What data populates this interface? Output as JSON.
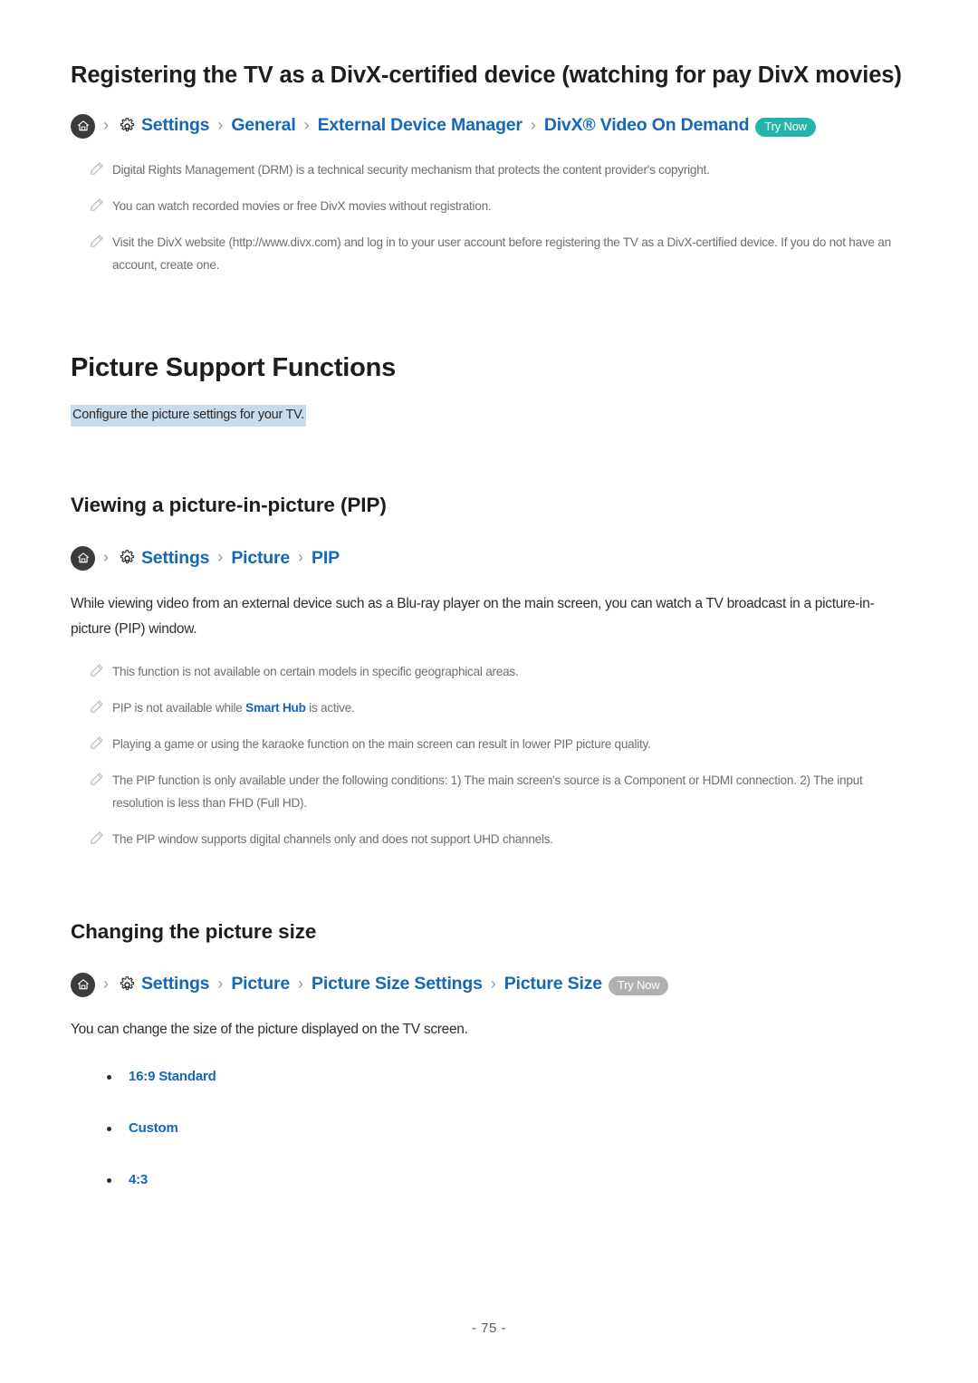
{
  "document": {
    "page_number": "- 75 -"
  },
  "section_divx": {
    "heading": "Registering the TV as a DivX-certified device (watching for pay DivX movies)",
    "breadcrumb": {
      "home_icon": "home-icon",
      "gear_icon": "gear-icon",
      "separator": "›",
      "items": [
        "Settings",
        "General",
        "External Device Manager",
        "DivX® Video On Demand"
      ],
      "badge": "Try Now",
      "badge_color": "#23b5ab"
    },
    "notes": [
      "Digital Rights Management (DRM) is a technical security mechanism that protects the content provider's copyright.",
      "You can watch recorded movies or free DivX movies without registration.",
      "Visit the DivX website (http://www.divx.com) and log in to your user account before registering the TV as a DivX-certified device. If you do not have an account, create one."
    ]
  },
  "section_picture_support": {
    "heading": "Picture Support Functions",
    "lead": "Configure the picture settings for your TV.",
    "lead_highlight_color": "#c6dcef"
  },
  "section_pip": {
    "heading": "Viewing a picture-in-picture (PIP)",
    "breadcrumb": {
      "home_icon": "home-icon",
      "gear_icon": "gear-icon",
      "separator": "›",
      "items": [
        "Settings",
        "Picture",
        "PIP"
      ]
    },
    "body": "While viewing video from an external device such as a Blu-ray player on the main screen, you can watch a TV broadcast in a picture-in-picture (PIP) window.",
    "notes": [
      {
        "text": "This function is not available on certain models in specific geographical areas."
      },
      {
        "prefix": "PIP is not available while ",
        "link": "Smart Hub",
        "suffix": " is active."
      },
      {
        "text": "Playing a game or using the karaoke function on the main screen can result in lower PIP picture quality."
      },
      {
        "text": "The PIP function is only available under the following conditions: 1) The main screen's source is a Component or HDMI connection. 2) The input resolution is less than FHD (Full HD)."
      },
      {
        "text": "The PIP window supports digital channels only and does not support UHD channels."
      }
    ]
  },
  "section_picture_size": {
    "heading": "Changing the picture size",
    "breadcrumb": {
      "home_icon": "home-icon",
      "gear_icon": "gear-icon",
      "separator": "›",
      "items": [
        "Settings",
        "Picture",
        "Picture Size Settings",
        "Picture Size"
      ],
      "badge": "Try Now",
      "badge_color": "#b0b0b0"
    },
    "body": "You can change the size of the picture displayed on the TV screen.",
    "options": [
      "16:9 Standard",
      "Custom",
      "4:3"
    ]
  },
  "theme": {
    "link_color": "#1467ba",
    "text_color": "#2b2b2b",
    "note_color": "#6f6f6f",
    "separator_color": "#8a9aa9"
  }
}
